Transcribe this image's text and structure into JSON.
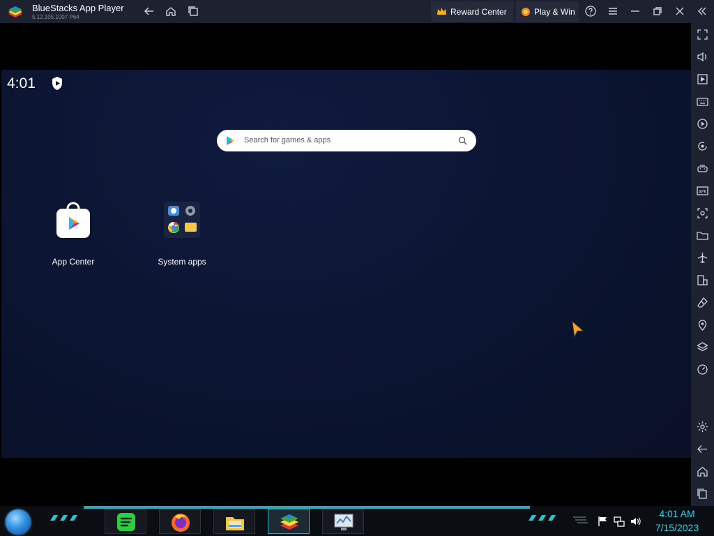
{
  "window": {
    "title": "BlueStacks App Player",
    "version": "5.12.105.1007  P64",
    "reward_center_label": "Reward Center",
    "play_win_label": "Play & Win"
  },
  "titlebar_icons": [
    "back-icon",
    "home-icon",
    "multi-instance-icon",
    "help-icon",
    "menu-icon",
    "minimize-icon",
    "restore-icon",
    "close-icon",
    "collapse-sidebar-icon"
  ],
  "sidebar_icons": [
    "fullscreen-icon",
    "volume-icon",
    "media-icon",
    "keyboard-icon",
    "macro-icon",
    "rotate-icon",
    "gamepad-icon",
    "apk-icon",
    "screenshot-icon",
    "folder-icon",
    "airplane-icon",
    "multi-instance-icon",
    "eraser-icon",
    "location-icon",
    "layers-icon",
    "performance-icon",
    "settings-icon",
    "back-icon",
    "home-icon",
    "recents-icon"
  ],
  "android": {
    "status_time": "4:01",
    "search_placeholder": "Search for games & apps",
    "apps": [
      {
        "label": "App Center",
        "icon": "app-center-icon"
      },
      {
        "label": "System apps",
        "icon": "system-apps-icon"
      }
    ]
  },
  "taskbar": {
    "apps": [
      "spotify-icon",
      "firefox-icon",
      "file-explorer-icon",
      "bluestacks-icon",
      "system-monitor-icon"
    ],
    "tray_icons": [
      "action-center-flag-icon",
      "network-icon",
      "volume-icon"
    ],
    "time": "4:01 AM",
    "date": "7/15/2023"
  },
  "colors": {
    "titlebar": "#1e2130",
    "android_bg": "#0b1430",
    "tray_text": "#25d7e6",
    "taskbar_accent": "#27a9b9"
  }
}
